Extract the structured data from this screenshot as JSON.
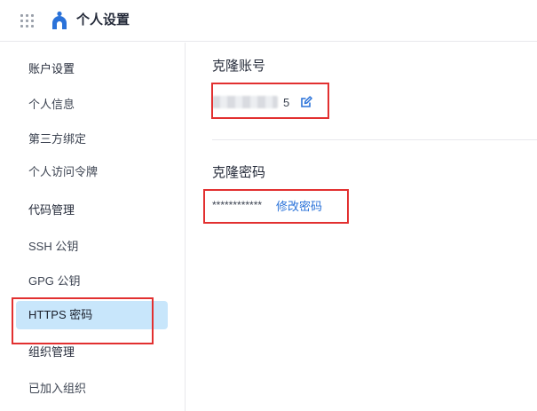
{
  "header": {
    "title": "个人设置",
    "apps_icon": "apps-grid-icon",
    "logo_icon": "user-logo-icon"
  },
  "sidebar": {
    "items": [
      {
        "label": "账户设置"
      },
      {
        "label": "个人信息"
      },
      {
        "label": "第三方绑定"
      },
      {
        "label": "个人访问令牌"
      },
      {
        "label": "代码管理"
      },
      {
        "label": "SSH 公钥"
      },
      {
        "label": "GPG 公钥"
      },
      {
        "label": "HTTPS 密码"
      },
      {
        "label": "组织管理"
      },
      {
        "label": "已加入组织"
      }
    ],
    "active": "HTTPS 密码"
  },
  "main": {
    "account_title": "克隆账号",
    "account_suffix": "5",
    "password_title": "克隆密码",
    "password_masked": "************",
    "change_password_label": "修改密码"
  },
  "colors": {
    "accent": "#2a72d9",
    "active_bg": "#c8e6fb",
    "highlight": "#e23030"
  }
}
